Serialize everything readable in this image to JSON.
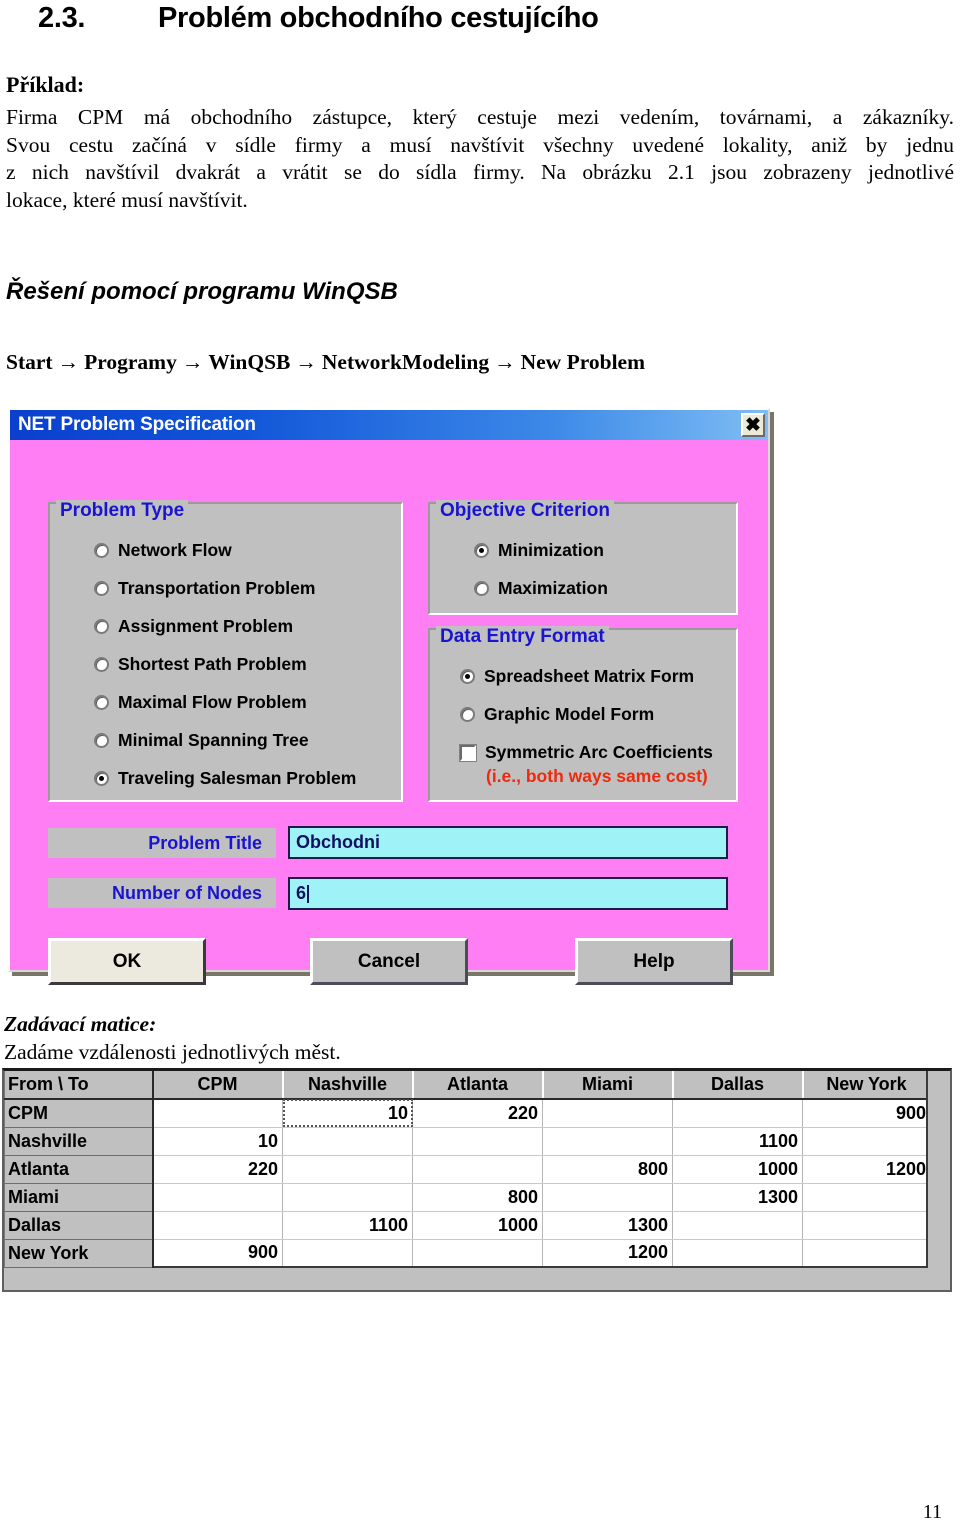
{
  "document": {
    "heading_number": "2.3.",
    "heading_title": "Problém obchodního cestujícího",
    "example_label": "Příklad:",
    "paragraph_line1": "Firma CPM má obchodního zástupce, který cestuje mezi vedením, továrnami, a zákazníky.",
    "paragraph_line2": "Svou cestu začíná v sídle firmy a musí navštívit všechny uvedené lokality, aniž by jednu",
    "paragraph_line3": "z nich navštívil dvakrát a vrátit se do sídla firmy. Na obrázku 2.1 jsou zobrazeny jednotlivé",
    "paragraph_line4": "lokace, které musí navštívit.",
    "solution_heading": "Řešení pomocí programu WinQSB",
    "menu_path": [
      "Start",
      "Programy",
      "WinQSB",
      "NetworkModeling",
      "New Problem"
    ],
    "menu_path_arrow": "→",
    "matrix_label": "Zadávací matice:",
    "matrix_sublabel": "Zadáme vzdálenosti jednotlivých měst.",
    "page_number": "11"
  },
  "dialog": {
    "title": "NET Problem Specification",
    "close_icon": "close-icon",
    "close_glyph": "✖",
    "problem_type": {
      "legend": "Problem Type",
      "options": [
        {
          "label": "Network Flow",
          "selected": false
        },
        {
          "label": "Transportation Problem",
          "selected": false
        },
        {
          "label": "Assignment Problem",
          "selected": false
        },
        {
          "label": "Shortest Path Problem",
          "selected": false
        },
        {
          "label": "Maximal Flow Problem",
          "selected": false
        },
        {
          "label": "Minimal Spanning Tree",
          "selected": false
        },
        {
          "label": "Traveling Salesman Problem",
          "selected": true
        }
      ]
    },
    "objective_criterion": {
      "legend": "Objective Criterion",
      "options": [
        {
          "label": "Minimization",
          "selected": true
        },
        {
          "label": "Maximization",
          "selected": false
        }
      ]
    },
    "data_entry_format": {
      "legend": "Data Entry Format",
      "options": [
        {
          "label": "Spreadsheet Matrix Form",
          "selected": true
        },
        {
          "label": "Graphic Model Form",
          "selected": false
        }
      ],
      "checkbox_label": "Symmetric Arc Coefficients",
      "checkbox_checked": false,
      "note": "(i.e., both ways same cost)"
    },
    "fields": [
      {
        "label": "Problem Title",
        "value": "Obchodni"
      },
      {
        "label": "Number of Nodes",
        "value": "6"
      }
    ],
    "buttons": [
      {
        "label": "OK",
        "focused": true
      },
      {
        "label": "Cancel",
        "focused": false
      },
      {
        "label": "Help",
        "focused": false
      }
    ],
    "colors": {
      "body_pink": "#ff7ef4",
      "titlebar_blue": "#0b3fcf",
      "group_gray": "#c0c0c0",
      "legend_blue": "#1a14d2",
      "input_cyan": "#9ff3f7",
      "note_red": "#ef2a0c"
    }
  },
  "matrix": {
    "corner_header": "From \\ To",
    "columns": [
      "CPM",
      "Nashville",
      "Atlanta",
      "Miami",
      "Dallas",
      "New York"
    ],
    "rows": [
      {
        "name": "CPM",
        "values": [
          "",
          "10",
          "220",
          "",
          "",
          "900"
        ]
      },
      {
        "name": "Nashville",
        "values": [
          "10",
          "",
          "",
          "",
          "1100",
          ""
        ]
      },
      {
        "name": "Atlanta",
        "values": [
          "220",
          "",
          "",
          "800",
          "1000",
          "1200"
        ]
      },
      {
        "name": "Miami",
        "values": [
          "",
          "",
          "800",
          "",
          "1300",
          ""
        ]
      },
      {
        "name": "Dallas",
        "values": [
          "",
          "1100",
          "1000",
          "1300",
          "",
          ""
        ]
      },
      {
        "name": "New York",
        "values": [
          "900",
          "",
          "",
          "1200",
          "",
          ""
        ]
      }
    ],
    "selected_cell": {
      "row": 0,
      "col": 1
    }
  }
}
